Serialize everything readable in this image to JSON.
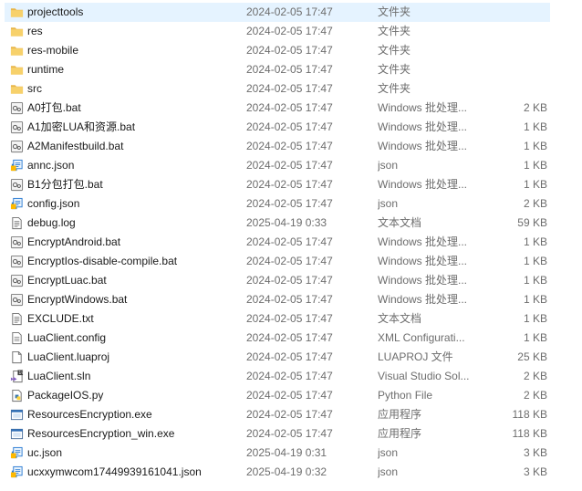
{
  "files": [
    {
      "name": "projecttools",
      "date": "2024-02-05 17:47",
      "type": "文件夹",
      "size": "",
      "icon": "folder-icon",
      "selected": true
    },
    {
      "name": "res",
      "date": "2024-02-05 17:47",
      "type": "文件夹",
      "size": "",
      "icon": "folder-icon"
    },
    {
      "name": "res-mobile",
      "date": "2024-02-05 17:47",
      "type": "文件夹",
      "size": "",
      "icon": "folder-icon"
    },
    {
      "name": "runtime",
      "date": "2024-02-05 17:47",
      "type": "文件夹",
      "size": "",
      "icon": "folder-icon"
    },
    {
      "name": "src",
      "date": "2024-02-05 17:47",
      "type": "文件夹",
      "size": "",
      "icon": "folder-icon"
    },
    {
      "name": "A0打包.bat",
      "date": "2024-02-05 17:47",
      "type": "Windows 批处理...",
      "size": "2 KB",
      "icon": "batch-file-icon"
    },
    {
      "name": "A1加密LUA和资源.bat",
      "date": "2024-02-05 17:47",
      "type": "Windows 批处理...",
      "size": "1 KB",
      "icon": "batch-file-icon"
    },
    {
      "name": "A2Manifestbuild.bat",
      "date": "2024-02-05 17:47",
      "type": "Windows 批处理...",
      "size": "1 KB",
      "icon": "batch-file-icon"
    },
    {
      "name": "annc.json",
      "date": "2024-02-05 17:47",
      "type": "json",
      "size": "1 KB",
      "icon": "json-file-icon"
    },
    {
      "name": "B1分包打包.bat",
      "date": "2024-02-05 17:47",
      "type": "Windows 批处理...",
      "size": "1 KB",
      "icon": "batch-file-icon"
    },
    {
      "name": "config.json",
      "date": "2024-02-05 17:47",
      "type": "json",
      "size": "2 KB",
      "icon": "json-file-icon"
    },
    {
      "name": "debug.log",
      "date": "2025-04-19 0:33",
      "type": "文本文档",
      "size": "59 KB",
      "icon": "text-file-icon"
    },
    {
      "name": "EncryptAndroid.bat",
      "date": "2024-02-05 17:47",
      "type": "Windows 批处理...",
      "size": "1 KB",
      "icon": "batch-file-icon"
    },
    {
      "name": "EncryptIos-disable-compile.bat",
      "date": "2024-02-05 17:47",
      "type": "Windows 批处理...",
      "size": "1 KB",
      "icon": "batch-file-icon"
    },
    {
      "name": "EncryptLuac.bat",
      "date": "2024-02-05 17:47",
      "type": "Windows 批处理...",
      "size": "1 KB",
      "icon": "batch-file-icon"
    },
    {
      "name": "EncryptWindows.bat",
      "date": "2024-02-05 17:47",
      "type": "Windows 批处理...",
      "size": "1 KB",
      "icon": "batch-file-icon"
    },
    {
      "name": "EXCLUDE.txt",
      "date": "2024-02-05 17:47",
      "type": "文本文档",
      "size": "1 KB",
      "icon": "text-file-icon"
    },
    {
      "name": "LuaClient.config",
      "date": "2024-02-05 17:47",
      "type": "XML Configurati...",
      "size": "1 KB",
      "icon": "config-file-icon"
    },
    {
      "name": "LuaClient.luaproj",
      "date": "2024-02-05 17:47",
      "type": "LUAPROJ 文件",
      "size": "25 KB",
      "icon": "blank-file-icon"
    },
    {
      "name": "LuaClient.sln",
      "date": "2024-02-05 17:47",
      "type": "Visual Studio Sol...",
      "size": "2 KB",
      "icon": "visual-studio-solution-icon"
    },
    {
      "name": "PackageIOS.py",
      "date": "2024-02-05 17:47",
      "type": "Python File",
      "size": "2 KB",
      "icon": "python-file-icon"
    },
    {
      "name": "ResourcesEncryption.exe",
      "date": "2024-02-05 17:47",
      "type": "应用程序",
      "size": "118 KB",
      "icon": "application-icon"
    },
    {
      "name": "ResourcesEncryption_win.exe",
      "date": "2024-02-05 17:47",
      "type": "应用程序",
      "size": "118 KB",
      "icon": "application-icon"
    },
    {
      "name": "uc.json",
      "date": "2025-04-19 0:31",
      "type": "json",
      "size": "3 KB",
      "icon": "json-file-icon"
    },
    {
      "name": "ucxxymwcom17449939161041.json",
      "date": "2025-04-19 0:32",
      "type": "json",
      "size": "3 KB",
      "icon": "json-file-icon"
    }
  ]
}
